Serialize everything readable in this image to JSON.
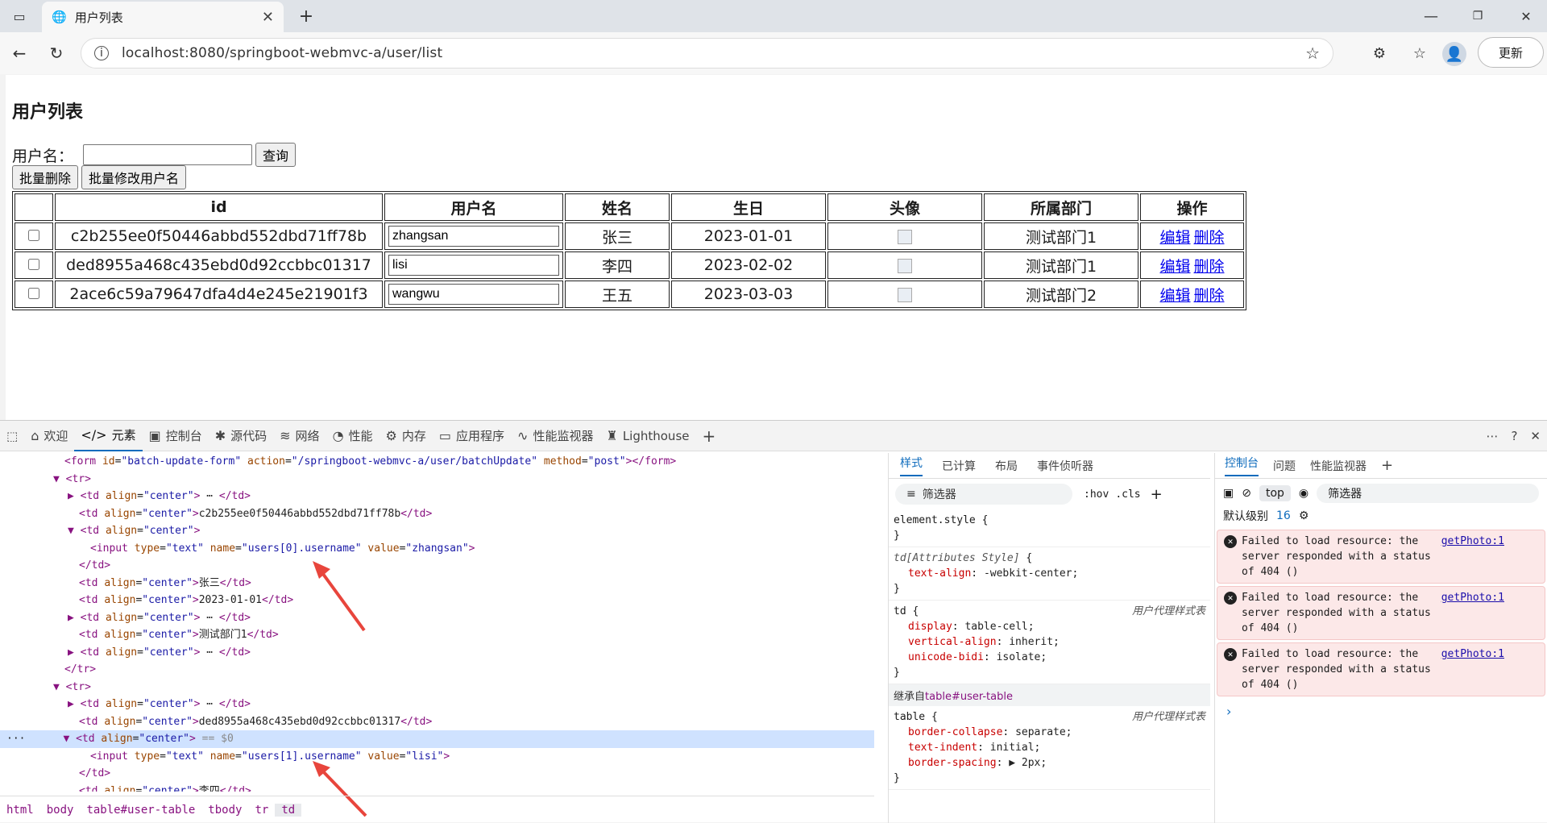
{
  "browser": {
    "tab_title": "用户列表",
    "url": "localhost:8080/springboot-webmvc-a/user/list",
    "update_label": "更新"
  },
  "page": {
    "heading": "用户列表",
    "search_label": "用户名：",
    "search_button": "查询",
    "batch_delete": "批量删除",
    "batch_update": "批量修改用户名",
    "table": {
      "headers": [
        "",
        "id",
        "用户名",
        "姓名",
        "生日",
        "头像",
        "所属部门",
        "操作"
      ],
      "rows": [
        {
          "id": "c2b255ee0f50446abbd552dbd71ff78b",
          "username": "zhangsan",
          "name": "张三",
          "birthday": "2023-01-01",
          "dept": "测试部门1"
        },
        {
          "id": "ded8955a468c435ebd0d92ccbbc01317",
          "username": "lisi",
          "name": "李四",
          "birthday": "2023-02-02",
          "dept": "测试部门1"
        },
        {
          "id": "2ace6c59a79647dfa4d4e245e21901f3",
          "username": "wangwu",
          "name": "王五",
          "birthday": "2023-03-03",
          "dept": "测试部门2"
        }
      ],
      "edit": "编辑",
      "delete": "删除"
    }
  },
  "devtools": {
    "tabs": [
      "欢迎",
      "元素",
      "控制台",
      "源代码",
      "网络",
      "性能",
      "内存",
      "应用程序",
      "性能监视器",
      "Lighthouse"
    ],
    "breadcrumb": [
      "html",
      "body",
      "table#user-table",
      "tbody",
      "tr",
      "td"
    ],
    "styles_tabs": [
      "样式",
      "已计算",
      "布局",
      "事件侦听器"
    ],
    "filter_placeholder": "筛选器",
    "hov": ":hov",
    "cls": ".cls",
    "inherited_label": "继承自",
    "inherited_from": "table#user-table",
    "ua_label": "用户代理样式表",
    "console_tabs": [
      "控制台",
      "问题",
      "性能监视器"
    ],
    "context": "top",
    "level": "默认级别",
    "issue_count": "16",
    "errors": [
      {
        "text": "Failed to load resource: the server responded with a status of 404 ()",
        "source": "getPhoto:1"
      },
      {
        "text": "Failed to load resource: the server responded with a status of 404 ()",
        "source": "getPhoto:1"
      },
      {
        "text": "Failed to load resource: the server responded with a status of 404 ()",
        "source": "getPhoto:1"
      }
    ]
  }
}
